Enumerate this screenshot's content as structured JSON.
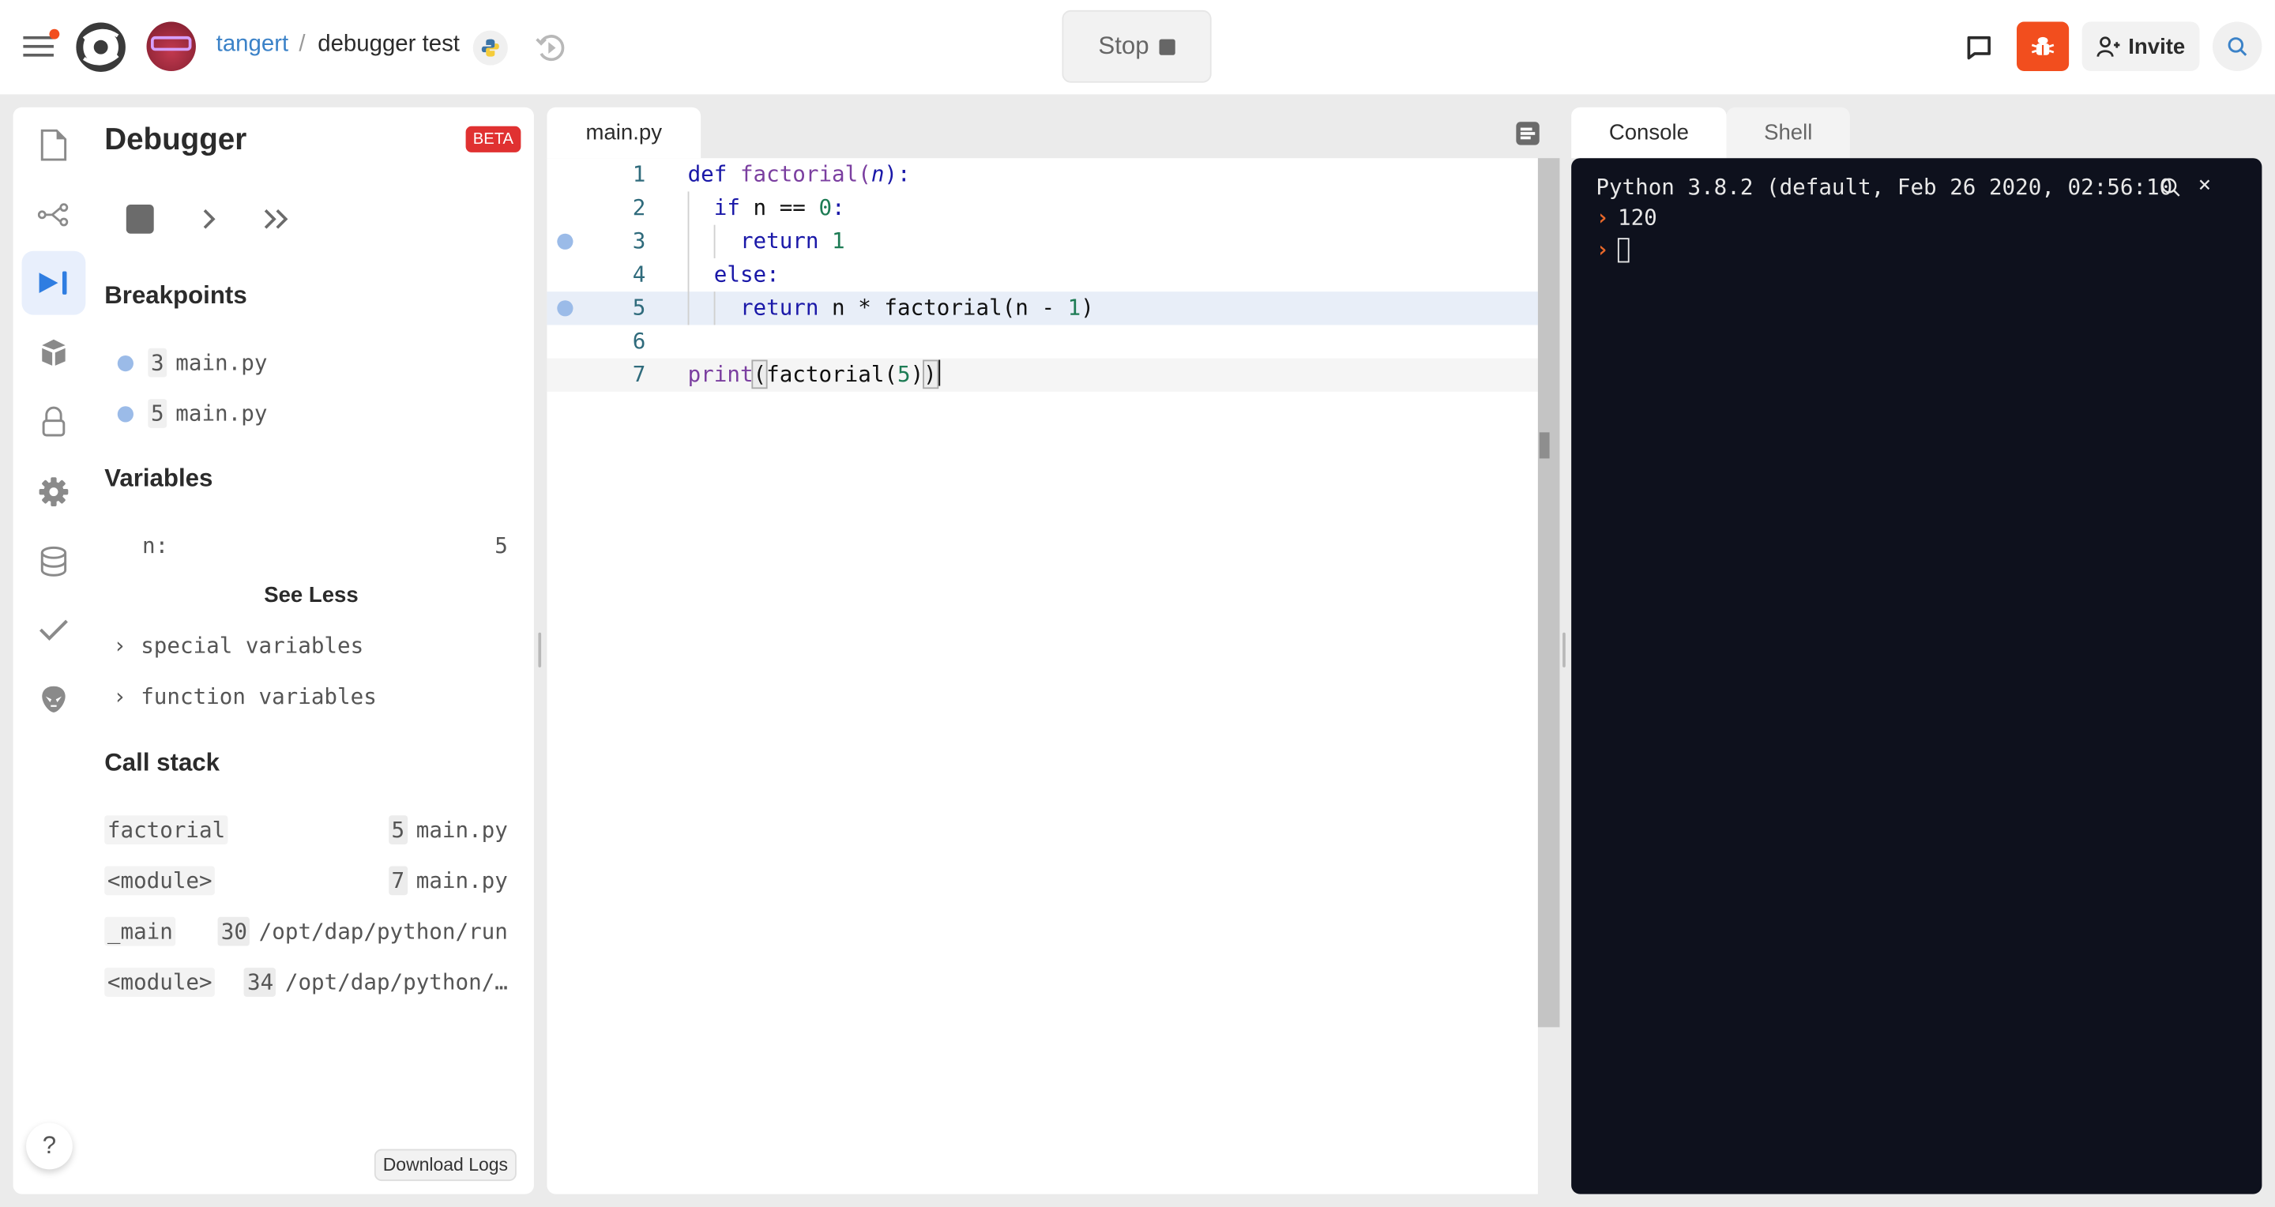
{
  "topbar": {
    "user": "tangert",
    "separator": "/",
    "project": "debugger test",
    "run_button_label": "Stop",
    "invite_label": "Invite",
    "accent_color": "#f24e1e",
    "icons": [
      "menu-icon",
      "replit-logo",
      "avatar",
      "python-icon",
      "history-icon",
      "stop-icon",
      "chat-icon",
      "bug-icon",
      "add-user-icon",
      "search-icon"
    ]
  },
  "sidebar_rail": {
    "items": [
      {
        "name": "files",
        "icon": "file-icon",
        "active": false
      },
      {
        "name": "version-control",
        "icon": "share-nodes-icon",
        "active": false
      },
      {
        "name": "debugger",
        "icon": "step-forward-icon",
        "active": true
      },
      {
        "name": "packages",
        "icon": "package-icon",
        "active": false
      },
      {
        "name": "secrets",
        "icon": "lock-icon",
        "active": false
      },
      {
        "name": "settings",
        "icon": "gear-icon",
        "active": false
      },
      {
        "name": "database",
        "icon": "database-icon",
        "active": false
      },
      {
        "name": "unit-tests",
        "icon": "check-icon",
        "active": false
      },
      {
        "name": "themes",
        "icon": "alien-icon",
        "active": false
      }
    ],
    "help_label": "?"
  },
  "debugger": {
    "title": "Debugger",
    "badge": "BETA",
    "controls": [
      "stop",
      "step",
      "continue"
    ],
    "breakpoints_heading": "Breakpoints",
    "breakpoints": [
      {
        "line": "3",
        "file": "main.py"
      },
      {
        "line": "5",
        "file": "main.py"
      }
    ],
    "variables_heading": "Variables",
    "variables": [
      {
        "name": "n:",
        "value": "5"
      }
    ],
    "see_less_label": "See Less",
    "expanders": [
      {
        "chevron": "›",
        "label": "special variables"
      },
      {
        "chevron": "›",
        "label": "function variables"
      }
    ],
    "callstack_heading": "Call stack",
    "callstack": [
      {
        "fn": "factorial",
        "line": "5",
        "file": "main.py"
      },
      {
        "fn": "<module>",
        "line": "7",
        "file": "main.py"
      },
      {
        "fn": "_main",
        "line": "30",
        "file": "/opt/dap/python/run"
      },
      {
        "fn": "<module>",
        "line": "34",
        "file": "/opt/dap/python/…"
      }
    ],
    "download_logs_label": "Download Logs"
  },
  "editor": {
    "tab": "main.py",
    "lines": [
      {
        "num": "1",
        "text": "def factorial(n):",
        "breakpoint": false
      },
      {
        "num": "2",
        "text": "  if n == 0:",
        "breakpoint": false
      },
      {
        "num": "3",
        "text": "    return 1",
        "breakpoint": true
      },
      {
        "num": "4",
        "text": "  else:",
        "breakpoint": false
      },
      {
        "num": "5",
        "text": "    return n * factorial(n - 1)",
        "breakpoint": true,
        "current": true
      },
      {
        "num": "6",
        "text": "",
        "breakpoint": false
      },
      {
        "num": "7",
        "text": "print(factorial(5))",
        "breakpoint": false,
        "cursor": true
      }
    ]
  },
  "console": {
    "tabs": [
      {
        "label": "Console",
        "active": true
      },
      {
        "label": "Shell",
        "active": false
      }
    ],
    "header": "Python 3.8.2 (default, Feb 26 2020, 02:56:10",
    "prompt_symbol": "›",
    "output": [
      "120"
    ],
    "close_label": "×"
  }
}
